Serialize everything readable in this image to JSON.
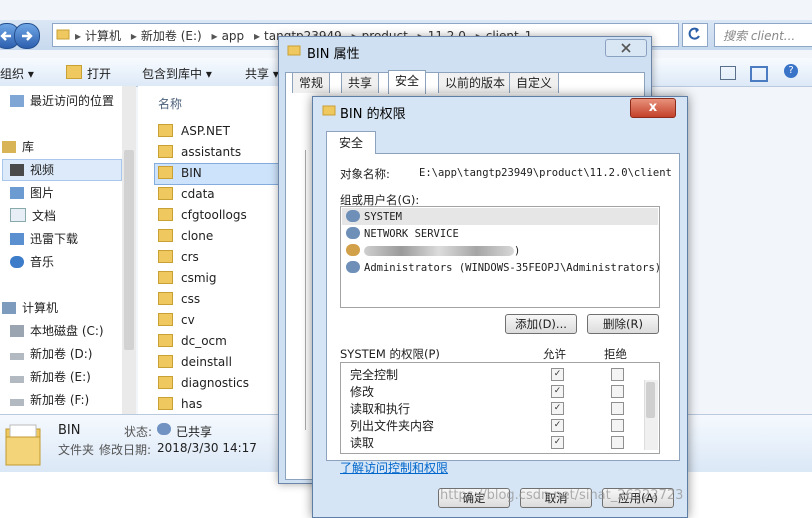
{
  "explorer": {
    "breadcrumbs": [
      "计算机",
      "新加卷 (E:)",
      "app",
      "tangtp23949",
      "product",
      "11.2.0",
      "client_1"
    ],
    "search_placeholder": "搜索 client...",
    "toolbar": [
      "组织 ▾",
      "打开",
      "包含到库中 ▾",
      "共享 ▾"
    ],
    "nav_items": [
      {
        "label": "最近访问的位置",
        "icon": "recent-places-icon"
      },
      {
        "label": "库",
        "icon": "library-icon"
      },
      {
        "label": "视频",
        "icon": "video-icon"
      },
      {
        "label": "图片",
        "icon": "pictures-icon"
      },
      {
        "label": "文档",
        "icon": "documents-icon"
      },
      {
        "label": "迅雷下载",
        "icon": "download-icon"
      },
      {
        "label": "音乐",
        "icon": "music-icon"
      },
      {
        "label": "计算机",
        "icon": "computer-icon"
      },
      {
        "label": "本地磁盘 (C:)",
        "icon": "drive-icon"
      },
      {
        "label": "新加卷 (D:)",
        "icon": "drive-icon"
      },
      {
        "label": "新加卷 (E:)",
        "icon": "drive-icon"
      },
      {
        "label": "新加卷 (F:)",
        "icon": "drive-icon"
      }
    ],
    "column_header": "名称",
    "files": [
      "ASP.NET",
      "assistants",
      "BIN",
      "cdata",
      "cfgtoollogs",
      "clone",
      "crs",
      "csmig",
      "css",
      "cv",
      "dc_ocm",
      "deinstall",
      "diagnostics",
      "has"
    ],
    "details": {
      "name": "BIN",
      "type": "文件夹",
      "status_label": "状态:",
      "status_value": "已共享",
      "modified_label": "修改日期:",
      "modified_value": "2018/3/30 14:17"
    }
  },
  "properties_dialog": {
    "title": "BIN 属性",
    "tabs": [
      "常规",
      "共享",
      "安全",
      "以前的版本",
      "自定义"
    ],
    "selected_tab": "安全",
    "ok_label": "确定"
  },
  "permissions_dialog": {
    "title": "BIN 的权限",
    "close_label": "x",
    "tab": "安全",
    "object_label": "对象名称:",
    "object_value": "E:\\app\\tangtp23949\\product\\11.2.0\\client",
    "groups_label": "组或用户名(G):",
    "users": [
      {
        "name": "SYSTEM"
      },
      {
        "name": "NETWORK SERVICE"
      },
      {
        "name": ")"
      },
      {
        "name": "Administrators (WINDOWS-35FEOPJ\\Administrators)"
      }
    ],
    "add_button": "添加(D)...",
    "remove_button": "删除(R)",
    "perm_label": "SYSTEM 的权限(P)",
    "allow_header": "允许",
    "deny_header": "拒绝",
    "permissions": [
      {
        "name": "完全控制",
        "allow": true,
        "deny": false
      },
      {
        "name": "修改",
        "allow": true,
        "deny": false
      },
      {
        "name": "读取和执行",
        "allow": true,
        "deny": false
      },
      {
        "name": "列出文件夹内容",
        "allow": true,
        "deny": false
      },
      {
        "name": "读取",
        "allow": true,
        "deny": false
      }
    ],
    "link_text": "了解访问控制和权限",
    "ok_button": "确定",
    "cancel_button": "取消",
    "apply_button": "应用(A)",
    "watermark": "https://blog.csdn.net/sinat_26222723"
  }
}
